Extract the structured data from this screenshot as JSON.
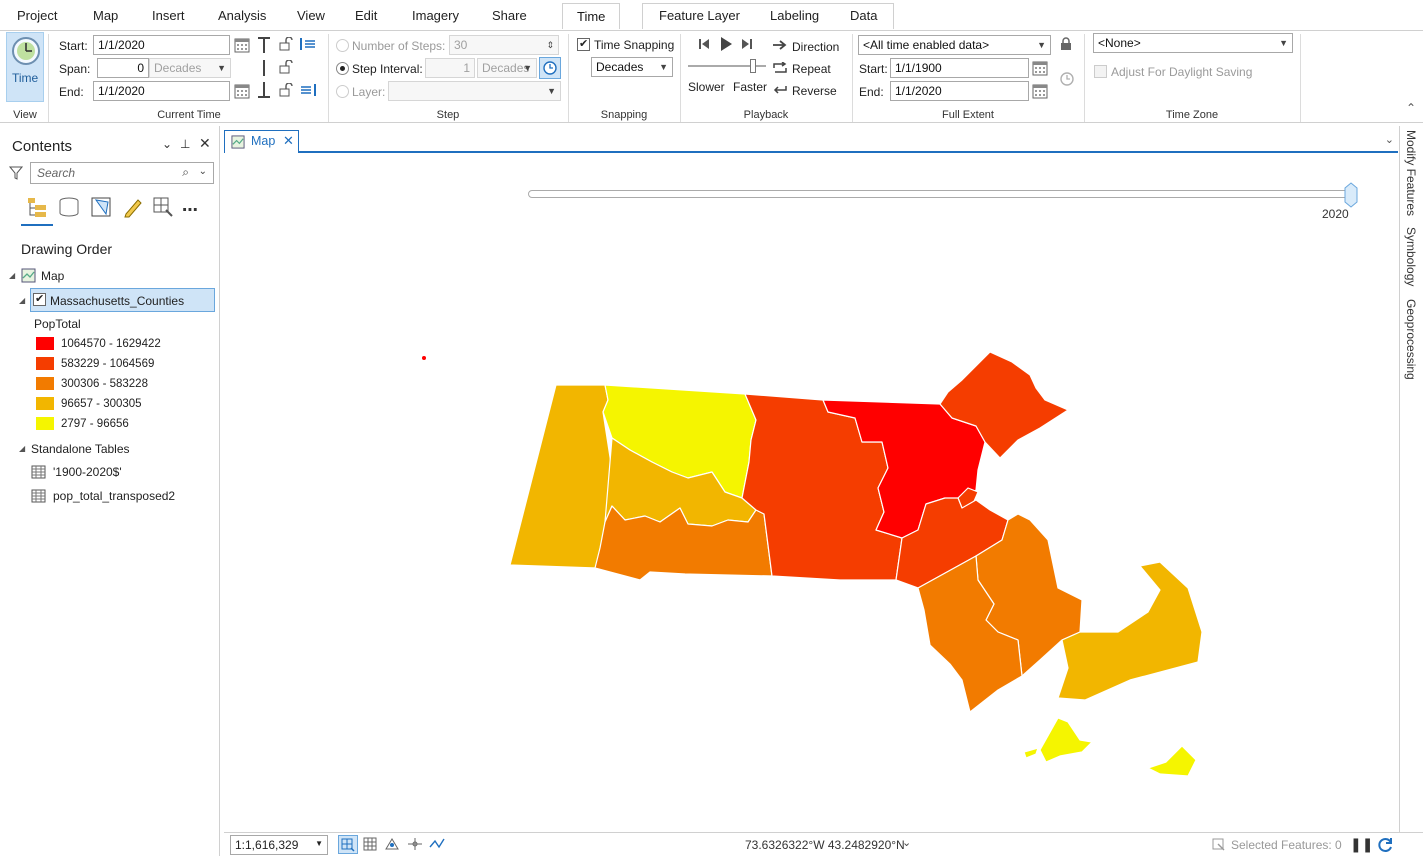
{
  "ribbon": {
    "tabs": [
      "Project",
      "Map",
      "Insert",
      "Analysis",
      "View",
      "Edit",
      "Imagery",
      "Share",
      "Time"
    ],
    "context_tabs": [
      "Feature Layer",
      "Labeling",
      "Data"
    ],
    "active_tab": "Time"
  },
  "view_group": {
    "time_button_label": "Time",
    "group_label": "View"
  },
  "current_time": {
    "start_label": "Start:",
    "start_value": "1/1/2020",
    "span_label": "Span:",
    "span_value": "0",
    "span_unit": "Decades",
    "end_label": "End:",
    "end_value": "1/1/2020",
    "group_label": "Current Time"
  },
  "step": {
    "num_steps_label": "Number of Steps:",
    "num_steps_value": "30",
    "interval_label": "Step Interval:",
    "interval_value": "1",
    "interval_unit": "Decades",
    "layer_label": "Layer:",
    "layer_value": "",
    "group_label": "Step"
  },
  "snapping": {
    "checkbox_label": "Time Snapping",
    "unit": "Decades",
    "group_label": "Snapping"
  },
  "playback": {
    "slower": "Slower",
    "faster": "Faster",
    "direction": "Direction",
    "repeat": "Repeat",
    "reverse": "Reverse",
    "group_label": "Playback"
  },
  "full_extent": {
    "dataset": "<All time enabled data>",
    "start_label": "Start:",
    "start_value": "1/1/1900",
    "end_label": "End:",
    "end_value": "1/1/2020",
    "group_label": "Full Extent"
  },
  "time_zone": {
    "value": "<None>",
    "dst_label": "Adjust For Daylight Saving",
    "group_label": "Time Zone"
  },
  "contents": {
    "title": "Contents",
    "search_placeholder": "Search",
    "drawing_order": "Drawing Order",
    "map_label": "Map",
    "layer_name": "Massachusetts_Counties",
    "renderer_field": "PopTotal",
    "classes": [
      {
        "label": "1064570 - 1629422",
        "color": "#ff0000"
      },
      {
        "label": "583229 - 1064569",
        "color": "#f53d00"
      },
      {
        "label": "300306 - 583228",
        "color": "#f27b00"
      },
      {
        "label": "96657 - 300305",
        "color": "#f2b600"
      },
      {
        "label": "2797 - 96656",
        "color": "#f5f500"
      }
    ],
    "standalone_tables": "Standalone Tables",
    "tables": [
      "'1900-2020$'",
      "pop_total_transposed2"
    ]
  },
  "map": {
    "tab_label": "Map",
    "slider_year": "2020",
    "slider_position": 1.0
  },
  "status": {
    "scale": "1:1,616,329",
    "coords": "73.6326322°W 43.2482920°N",
    "selected": "Selected Features: 0"
  },
  "right_dock": [
    "Modify Features",
    "Symbology",
    "Geoprocessing"
  ],
  "colors": {
    "accent": "#1f6fbf",
    "selection": "#cfe4f7"
  }
}
